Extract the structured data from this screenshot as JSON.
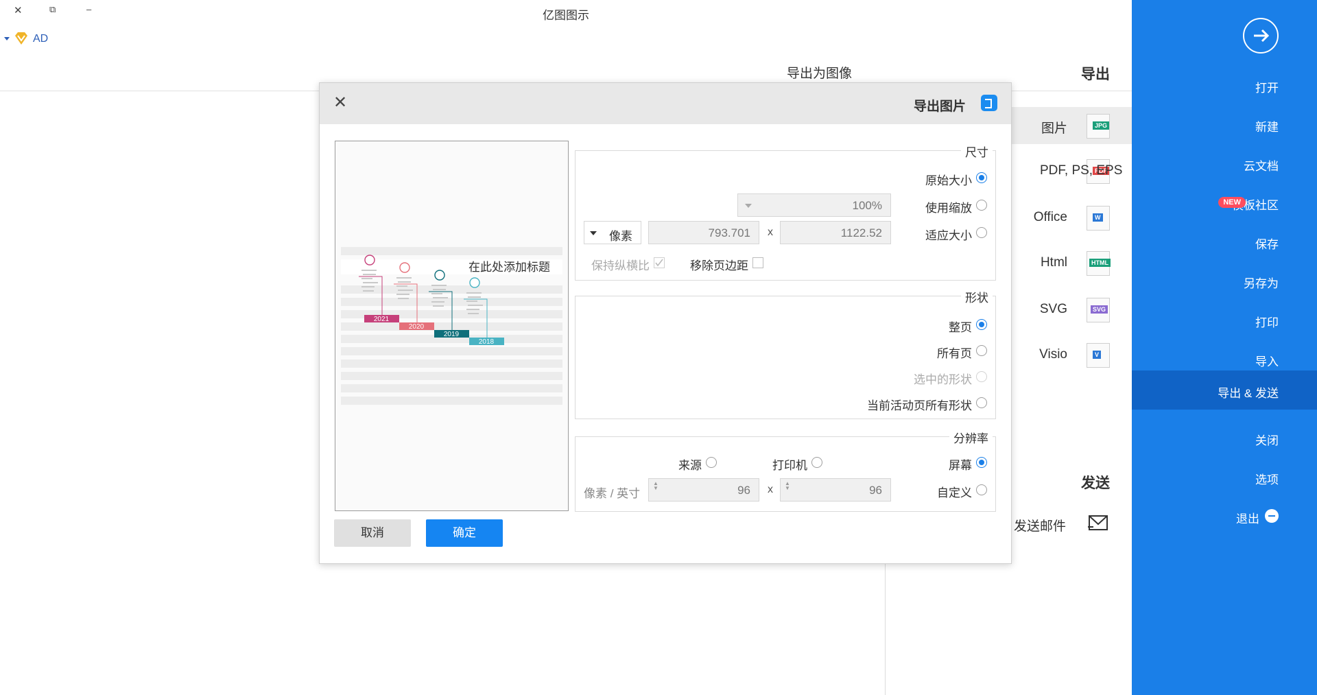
{
  "window": {
    "title": "亿图图示",
    "user_label": "AD",
    "minimize_glyph": "–",
    "restore_glyph": "⧉",
    "close_glyph": "✕"
  },
  "sidebar": {
    "items": [
      {
        "label": "打开"
      },
      {
        "label": "新建"
      },
      {
        "label": "云文档"
      },
      {
        "label": "模板社区",
        "badge": "NEW"
      },
      {
        "label": "保存"
      },
      {
        "label": "另存为"
      },
      {
        "label": "打印"
      },
      {
        "label": "导入"
      },
      {
        "label": "导出 & 发送",
        "active": true
      },
      {
        "label": "关闭"
      },
      {
        "label": "选项"
      },
      {
        "label": "退出"
      }
    ]
  },
  "export_panel": {
    "heading": "导出",
    "page_heading": "导出为图像",
    "formats": [
      {
        "label": "图片",
        "icon_text": "JPG",
        "icon_color": "#1a9f7a"
      },
      {
        "label": "PDF, PS, EPS",
        "icon_text": "PDF",
        "icon_color": "#e04646"
      },
      {
        "label": "Office",
        "icon_text": "W",
        "icon_color": "#2b78d6"
      },
      {
        "label": "Html",
        "icon_text": "HTML",
        "icon_color": "#1a9f7a"
      },
      {
        "label": "SVG",
        "icon_text": "SVG",
        "icon_color": "#8a6bd1"
      },
      {
        "label": "Visio",
        "icon_text": "V",
        "icon_color": "#2b78d6"
      }
    ],
    "send_heading": "发送",
    "send_email": "发送邮件"
  },
  "dialog": {
    "title": "导出图片",
    "size_group": {
      "title": "尺寸",
      "original": "原始大小",
      "scale": "使用缩放",
      "scale_value": "100%",
      "fit": "适应大小",
      "width": "1122.52",
      "height": "793.701",
      "x_sep": "x",
      "unit": "像素",
      "remove_margin": "移除页边距",
      "keep_ratio": "保持纵横比"
    },
    "shape_group": {
      "title": "形状",
      "whole_page": "整页",
      "all_pages": "所有页",
      "selected": "选中的形状",
      "active_page": "当前活动页所有形状"
    },
    "resolution_group": {
      "title": "分辨率",
      "screen": "屏幕",
      "printer": "打印机",
      "source": "来源",
      "custom": "自定义",
      "res_x": "96",
      "res_y": "96",
      "x_sep": "x",
      "unit": "像素 / 英寸"
    },
    "ok": "确定",
    "cancel": "取消"
  },
  "preview": {
    "heading": "在此处添加标题",
    "years": [
      "2021",
      "2020",
      "2019",
      "2018"
    ],
    "colors": [
      "#c6407a",
      "#e5707a",
      "#0f6f7b",
      "#49b3c3"
    ]
  }
}
